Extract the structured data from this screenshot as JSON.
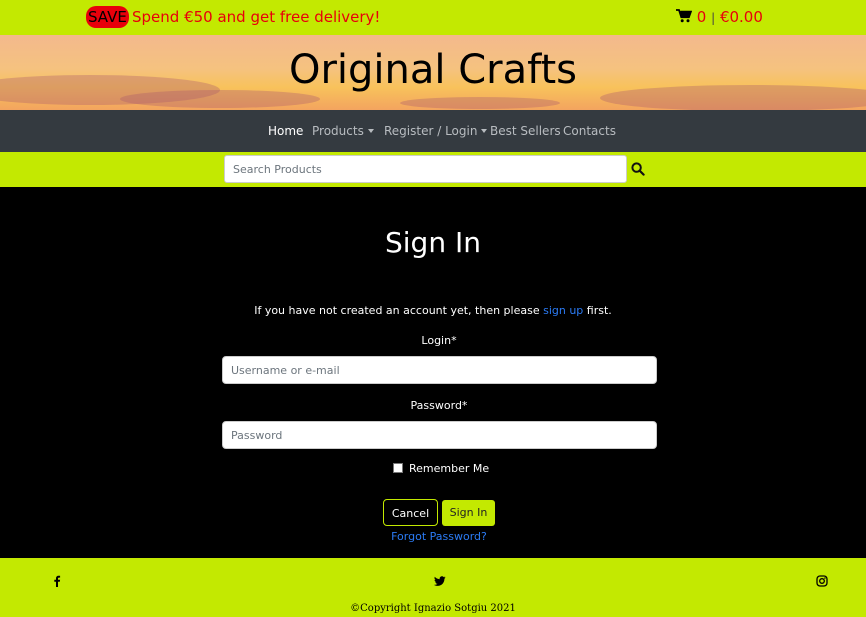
{
  "topbar": {
    "badge": "SAVE",
    "promo": "Spend €50 and get free delivery!",
    "cart_count": "0",
    "cart_separator": "|",
    "cart_total": "€0.00",
    "cart_icon": "shopping-cart-icon"
  },
  "header": {
    "brand": "Original Crafts"
  },
  "nav": {
    "items": [
      {
        "label": "Home",
        "active": true
      },
      {
        "label": "Products",
        "dropdown": true
      },
      {
        "label": "Register / Login",
        "dropdown": true
      },
      {
        "label": "Best Sellers"
      },
      {
        "label": "Contacts"
      }
    ]
  },
  "search": {
    "placeholder": "Search Products",
    "icon": "search-icon"
  },
  "signin": {
    "title": "Sign In",
    "intro_before": "If you have not created an account yet, then please ",
    "intro_link": "sign up",
    "intro_after": " first.",
    "login_label": "Login*",
    "login_placeholder": "Username or e-mail",
    "password_label": "Password*",
    "password_placeholder": "Password",
    "remember_label": "Remember Me",
    "cancel_label": "Cancel",
    "submit_label": "Sign In",
    "forgot_label": "Forgot Password?"
  },
  "footer": {
    "social": [
      "facebook-icon",
      "twitter-icon",
      "instagram-icon"
    ],
    "copyright": "©Copyright Ignazio Sotgiu 2021"
  },
  "colors": {
    "accent": "#c3e901",
    "promo": "#e8000b",
    "nav_bg": "#343a40",
    "link": "#2b7bf5"
  }
}
